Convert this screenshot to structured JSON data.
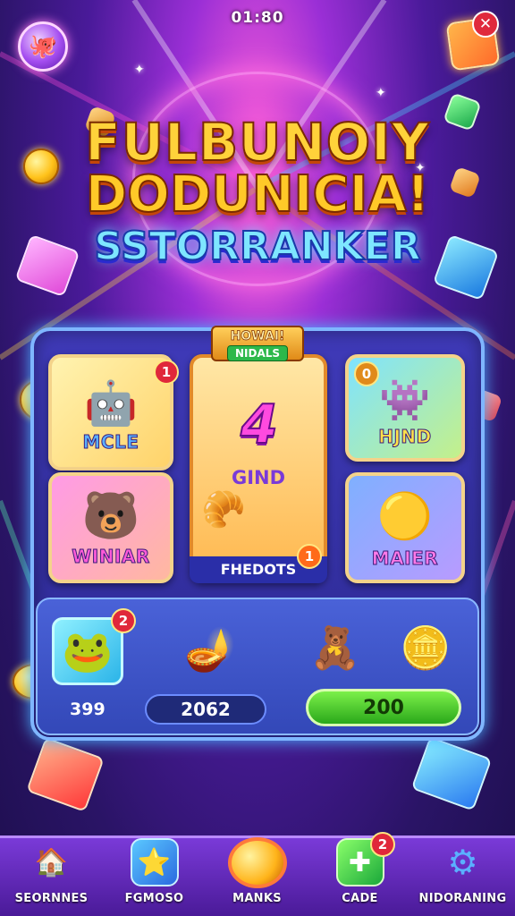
{
  "header": {
    "time": "01:80",
    "close_glyph": "✕",
    "avatar_icon": "mascot-icon",
    "gift_icon": "gift-box-icon"
  },
  "title": {
    "line1": "FULBUNOIY",
    "line2": "DODUNICIA!",
    "line3": "SSTORRANKER"
  },
  "board": {
    "center_banner_top": "HOWAI!",
    "center_banner_tag": "NIDALS",
    "cards": {
      "mcle": {
        "label": "MCLE",
        "badge": "1"
      },
      "winiar": {
        "label": "WINIAR"
      },
      "center": {
        "number": "4",
        "label": "GIND",
        "footer": "FHEDOTS",
        "badge": "1"
      },
      "hjnd": {
        "label": "HJND",
        "badge": "0"
      },
      "maier": {
        "label": "MAIER"
      }
    }
  },
  "bottom_row": {
    "frog_badge": "2",
    "left_value": "399",
    "middle_value": "2062",
    "right_value": "200"
  },
  "navbar": {
    "items": [
      {
        "label": "SEORNNES",
        "icon": "home-icon"
      },
      {
        "label": "FGMOSO",
        "icon": "shop-icon"
      },
      {
        "label": "MANKS",
        "icon": "coin-button-icon"
      },
      {
        "label": "CADE",
        "icon": "card-icon",
        "badge": "2"
      },
      {
        "label": "NIDORANING",
        "icon": "gear-icon"
      }
    ]
  },
  "colors": {
    "background": "#2a1466",
    "title_gold": "#ffd23a",
    "title_blue": "#7ee6ff",
    "board_border": "#7fb6ff",
    "green_pill": "#2aa81a",
    "badge_red": "#e0283a"
  }
}
